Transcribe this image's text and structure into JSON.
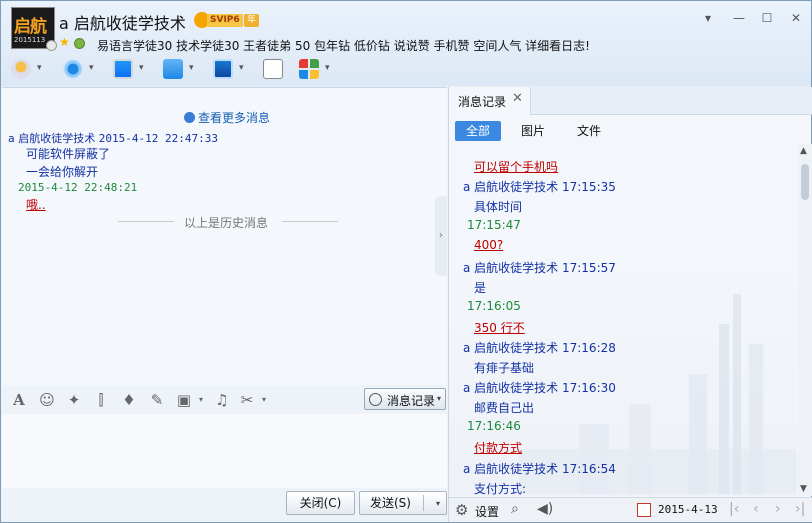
{
  "header": {
    "avatar_text": "启航",
    "avatar_sub": "2015113",
    "contact_name": "a 启航收徒学技术",
    "vip_label": "SVIP6",
    "year_label": "年",
    "signature": "易语言学徒30 技术学徒30 王者徒弟 50 包年钻 低价钻  说说赞 手机赞 空间人气 详细看日志!"
  },
  "window_controls": {
    "menu": "▾",
    "minimize": "—",
    "maximize": "☐",
    "close": "✕"
  },
  "toolbar": {
    "caret": "▾"
  },
  "chat": {
    "more_messages": "查看更多消息",
    "messages": [
      {
        "type": "contact_head",
        "name": "a 启航收徒学技术",
        "time": "2015-4-12 22:47:33"
      },
      {
        "type": "contact_body",
        "text": "可能软件屏蔽了"
      },
      {
        "type": "contact_body",
        "text": "一会给你解开"
      },
      {
        "type": "self_head",
        "time": "2015-4-12 22:48:21"
      },
      {
        "type": "self_body",
        "text": "哦.."
      }
    ],
    "history_divider": "以上是历史消息"
  },
  "input_toolbar": {
    "history_button": "消息记录"
  },
  "buttons": {
    "close": "关闭(C)",
    "send": "发送(S)"
  },
  "side_panel": {
    "tab_title": "消息记录",
    "filters": [
      "全部",
      "图片",
      "文件"
    ],
    "records": [
      {
        "kind": "red",
        "text": "可以留个手机吗"
      },
      {
        "kind": "contact_head",
        "text": "a 启航收徒学技术 17:15:35"
      },
      {
        "kind": "contact_body",
        "text": "具体时间"
      },
      {
        "kind": "self_head",
        "text": "17:15:47"
      },
      {
        "kind": "red",
        "text": "400?"
      },
      {
        "kind": "contact_head",
        "text": "a 启航收徒学技术 17:15:57"
      },
      {
        "kind": "contact_body",
        "text": "是"
      },
      {
        "kind": "self_head",
        "text": "17:16:05"
      },
      {
        "kind": "red",
        "text": "350  行不"
      },
      {
        "kind": "contact_head",
        "text": "a 启航收徒学技术 17:16:28"
      },
      {
        "kind": "contact_body",
        "text": "有痱子基础"
      },
      {
        "kind": "contact_head",
        "text": "a 启航收徒学技术 17:16:30"
      },
      {
        "kind": "contact_body",
        "text": "邮费自己出"
      },
      {
        "kind": "self_head",
        "text": "17:16:46"
      },
      {
        "kind": "red",
        "text": "付款方式"
      },
      {
        "kind": "contact_head",
        "text": "a 启航收徒学技术 17:16:54"
      },
      {
        "kind": "contact_body",
        "text": "支付方式:"
      }
    ],
    "settings_label": "设置",
    "date": "2015-4-13"
  },
  "colors": {
    "accent": "#3a88e0",
    "contact_text": "#1432a4",
    "self_text": "#1f8a3b",
    "red_text": "#c00000"
  }
}
